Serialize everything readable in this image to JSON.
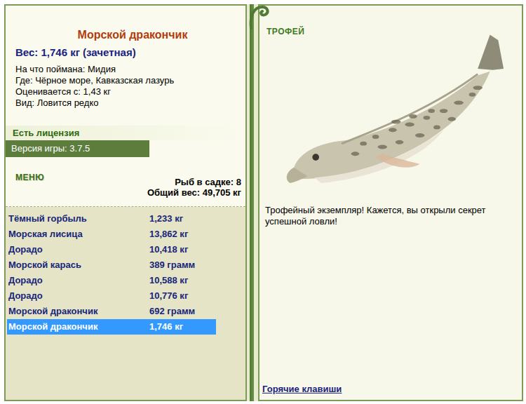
{
  "fish": {
    "name": "Морской дракончик",
    "weight": "Вес: 1,746 кг (зачетная)",
    "details": [
      "На что поймана: Мидия",
      "Где: Чёрное море, Кавказская лазурь",
      "Оценивается с: 1,43 кг",
      "Вид: Ловится редко"
    ]
  },
  "license": "Есть лицензия",
  "version": "Версия игры: 3.7.5",
  "menu": "МЕНЮ",
  "cage": {
    "count": "Рыб в садке: 8",
    "total": "Общий вес: 49,705 кг"
  },
  "catch": [
    {
      "name": "Тёмный горбыль",
      "weight": "1,233 кг",
      "selected": false
    },
    {
      "name": "Морская лисица",
      "weight": "13,862 кг",
      "selected": false
    },
    {
      "name": "Дорадо",
      "weight": "10,418 кг",
      "selected": false
    },
    {
      "name": "Морской карась",
      "weight": "389 грамм",
      "selected": false
    },
    {
      "name": "Дорадо",
      "weight": "10,588 кг",
      "selected": false
    },
    {
      "name": "Дорадо",
      "weight": "10,776 кг",
      "selected": false
    },
    {
      "name": "Морской дракончик",
      "weight": "692 грамм",
      "selected": false
    },
    {
      "name": "Морской дракончик",
      "weight": "1,746 кг",
      "selected": true
    }
  ],
  "trophy": {
    "label": "ТРОФЕЙ",
    "message": "Трофейный экземпляр! Кажется, вы открыли секрет успешной ловли!"
  },
  "hotkeys": "Горячие клавиши"
}
